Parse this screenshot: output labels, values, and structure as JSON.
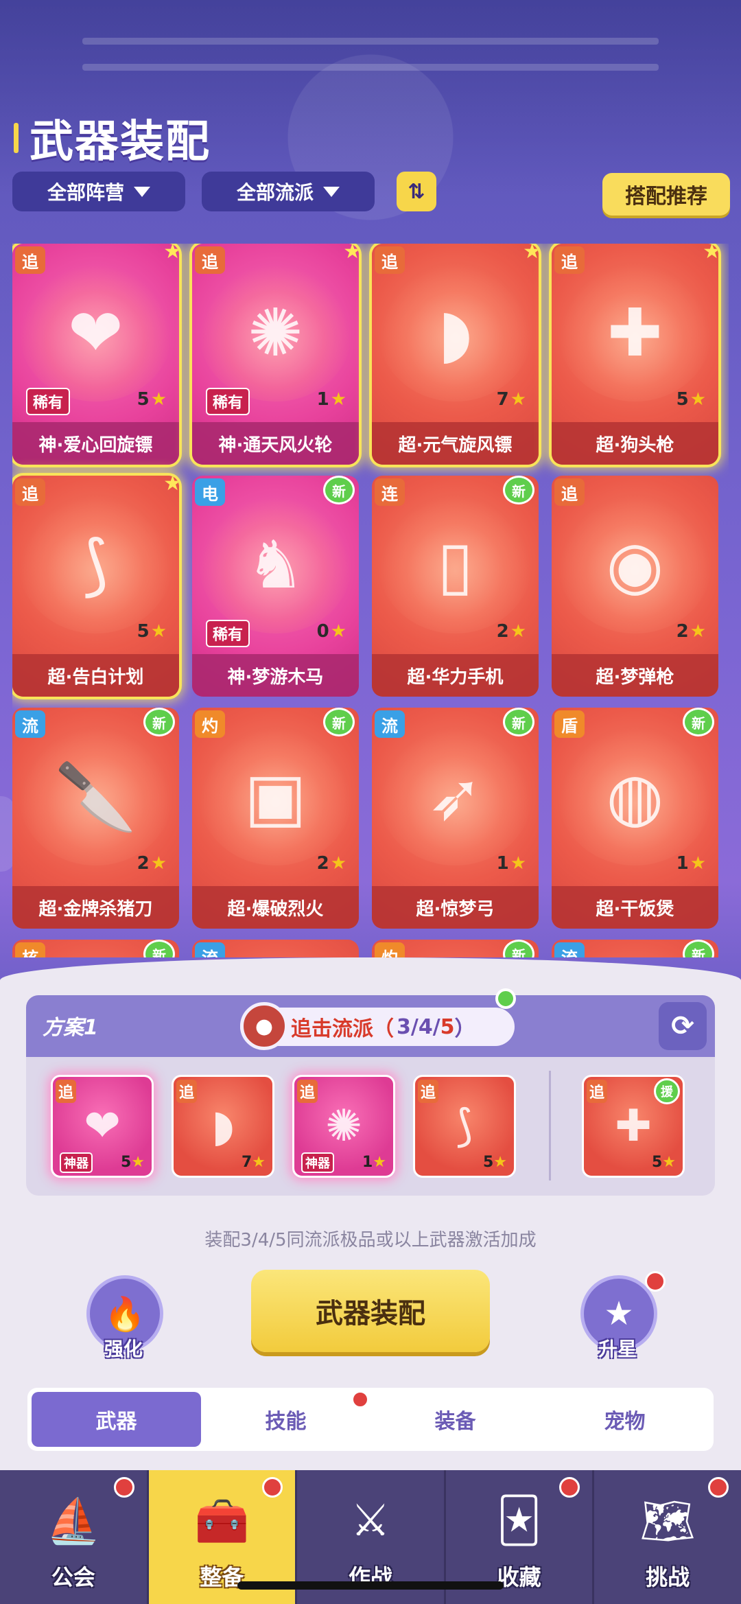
{
  "header": {
    "title": "武器装配"
  },
  "filters": {
    "faction_label": "全部阵营",
    "school_label": "全部流派",
    "sort_icon": "sort-arrows",
    "recommend_label": "搭配推荐"
  },
  "weapons": [
    {
      "name": "神·爱心回旋镖",
      "tag": "追",
      "level": "5",
      "rarity": "稀有",
      "style": "pink",
      "glow": true,
      "new": false
    },
    {
      "name": "神·通天风火轮",
      "tag": "追",
      "level": "1",
      "rarity": "稀有",
      "style": "pink",
      "glow": true,
      "new": false
    },
    {
      "name": "超·元气旋风镖",
      "tag": "追",
      "level": "7",
      "rarity": "",
      "style": "red",
      "glow": true,
      "new": false
    },
    {
      "name": "超·狗头枪",
      "tag": "追",
      "level": "5",
      "rarity": "",
      "style": "red",
      "glow": true,
      "new": false
    },
    {
      "name": "超·告白计划",
      "tag": "追",
      "level": "5",
      "rarity": "",
      "style": "red",
      "glow": true,
      "new": false
    },
    {
      "name": "神·梦游木马",
      "tag": "电",
      "level": "0",
      "rarity": "稀有",
      "style": "pink",
      "glow": false,
      "new": true
    },
    {
      "name": "超·华力手机",
      "tag": "连",
      "level": "2",
      "rarity": "",
      "style": "red",
      "glow": false,
      "new": true
    },
    {
      "name": "超·梦弹枪",
      "tag": "追",
      "level": "2",
      "rarity": "",
      "style": "red",
      "glow": false,
      "new": false
    },
    {
      "name": "超·金牌杀猪刀",
      "tag": "流",
      "level": "2",
      "rarity": "",
      "style": "red",
      "glow": false,
      "new": true
    },
    {
      "name": "超·爆破烈火",
      "tag": "灼",
      "level": "2",
      "rarity": "",
      "style": "red",
      "glow": false,
      "new": true
    },
    {
      "name": "超·惊梦弓",
      "tag": "流",
      "level": "1",
      "rarity": "",
      "style": "red",
      "glow": false,
      "new": true
    },
    {
      "name": "超·干饭煲",
      "tag": "盾",
      "level": "1",
      "rarity": "",
      "style": "red",
      "glow": false,
      "new": true
    },
    {
      "name": "",
      "tag": "核",
      "level": "",
      "rarity": "",
      "style": "red",
      "glow": false,
      "new": true
    },
    {
      "name": "",
      "tag": "流",
      "level": "",
      "rarity": "",
      "style": "red",
      "glow": false,
      "new": false
    },
    {
      "name": "",
      "tag": "灼",
      "level": "",
      "rarity": "",
      "style": "red",
      "glow": false,
      "new": true
    },
    {
      "name": "",
      "tag": "流",
      "level": "",
      "rarity": "",
      "style": "red",
      "glow": false,
      "new": true
    }
  ],
  "new_badge": "新",
  "plan": {
    "label": "方案1",
    "school_name": "追击流派（",
    "school_counts": "3/4/",
    "school_max": "5",
    "school_close": "）",
    "slots": [
      {
        "tag": "追",
        "badge": "神器",
        "level": "5",
        "style": "pink"
      },
      {
        "tag": "追",
        "badge": "",
        "level": "7",
        "style": "red"
      },
      {
        "tag": "追",
        "badge": "神器",
        "level": "1",
        "style": "pink"
      },
      {
        "tag": "追",
        "badge": "",
        "level": "5",
        "style": "red"
      }
    ],
    "assist_slot": {
      "tag": "追",
      "badge_label": "援",
      "level": "5"
    }
  },
  "hint": "装配3/4/5同流派极品或以上武器激活加成",
  "actions": {
    "enhance_label": "强化",
    "equip_label": "武器装配",
    "star_label": "升星"
  },
  "tabs": [
    "武器",
    "技能",
    "装备",
    "宠物"
  ],
  "active_tab": 0,
  "nav": [
    {
      "label": "公会",
      "icon": "ship-icon"
    },
    {
      "label": "整备",
      "icon": "toolbox-icon"
    },
    {
      "label": "作战",
      "icon": "crossed-swords-icon"
    },
    {
      "label": "收藏",
      "icon": "cards-icon"
    },
    {
      "label": "挑战",
      "icon": "map-icon"
    }
  ],
  "active_nav": 1,
  "colors": {
    "accent_yellow": "#f7d64a",
    "purple": "#7b6ad0",
    "red_dot": "#e0403e",
    "new_green": "#5fce4c"
  }
}
